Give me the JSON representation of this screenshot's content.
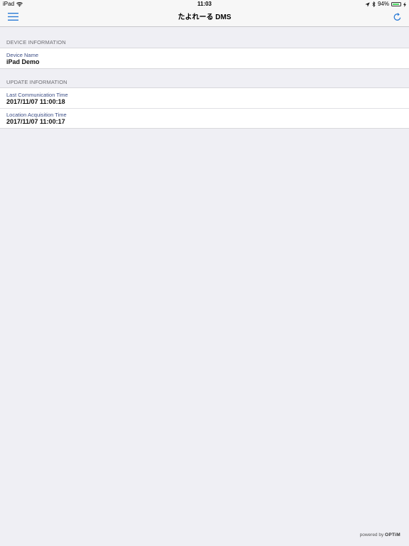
{
  "status_bar": {
    "device": "iPad",
    "time": "11:03",
    "battery_pct": "94%",
    "battery_level": 0.94
  },
  "nav": {
    "title": "たよれーる DMS"
  },
  "sections": {
    "device_info": {
      "header": "DEVICE INFORMATION",
      "rows": [
        {
          "label": "Device Name",
          "value": "iPad Demo"
        }
      ]
    },
    "update_info": {
      "header": "UPDATE INFORMATION",
      "rows": [
        {
          "label": "Last Communication Time",
          "value": "2017/11/07 11:00:18"
        },
        {
          "label": "Location Acquisition Time",
          "value": "2017/11/07 11:00:17"
        }
      ]
    }
  },
  "footer": {
    "powered_by": "powered by",
    "brand": "OPTiM"
  },
  "colors": {
    "accent": "#2a7bd6",
    "background": "#efeff4",
    "label": "#3c4e86",
    "battery": "#4cd964"
  },
  "icons": {
    "menu": "hamburger-menu-icon",
    "refresh": "refresh-icon",
    "wifi": "wifi-icon",
    "location": "location-arrow-icon",
    "bluetooth": "bluetooth-icon",
    "battery": "battery-icon",
    "charging": "charging-bolt-icon"
  }
}
